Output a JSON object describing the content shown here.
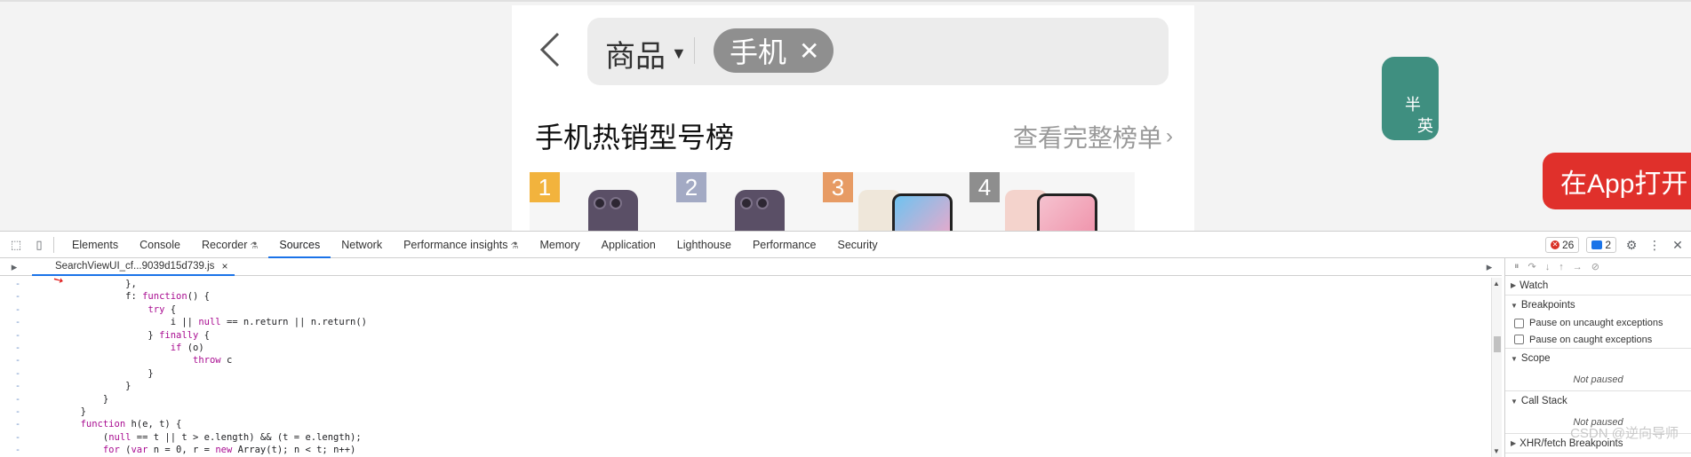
{
  "page": {
    "category_label": "商品",
    "search_chip": "手机",
    "hot_title": "手机热销型号榜",
    "full_list_label": "查看完整榜单",
    "rank_cards": [
      {
        "rank": "1",
        "color": "#f2b33d"
      },
      {
        "rank": "2",
        "color": "#a3aac4"
      },
      {
        "rank": "3",
        "color": "#e79b64"
      },
      {
        "rank": "4",
        "color": "#8e8e8e"
      }
    ],
    "app_icon_chars": [
      "半",
      "英"
    ],
    "open_app_label": "在App打开"
  },
  "devtools": {
    "tabs": [
      "Elements",
      "Console",
      "Recorder",
      "Sources",
      "Network",
      "Performance insights",
      "Memory",
      "Application",
      "Lighthouse",
      "Performance",
      "Security"
    ],
    "active_tab": "Sources",
    "error_count": "26",
    "message_count": "2",
    "file_tab": "SearchViewUI_cf...9039d15d739.js",
    "code_lines": [
      "                },",
      "                f: function() {",
      "                    try {",
      "                        i || null == n.return || n.return()",
      "                    } finally {",
      "                        if (o)",
      "                            throw c",
      "                    }",
      "                }",
      "            }",
      "        }",
      "        function h(e, t) {",
      "            (null == t || t > e.length) && (t = e.length);",
      "            for (var n = 0, r = new Array(t); n < t; n++)"
    ],
    "gutter_mark": "-",
    "sections": {
      "watch": "Watch",
      "breakpoints": "Breakpoints",
      "pause_uncaught": "Pause on uncaught exceptions",
      "pause_caught": "Pause on caught exceptions",
      "scope": "Scope",
      "not_paused_1": "Not paused",
      "call_stack": "Call Stack",
      "not_paused_2": "Not paused",
      "xhr": "XHR/fetch Breakpoints"
    },
    "watermark": "CSDN @逆向导师"
  },
  "colors": {
    "accent": "#1a73e8",
    "open_app_red": "#e0302b"
  }
}
